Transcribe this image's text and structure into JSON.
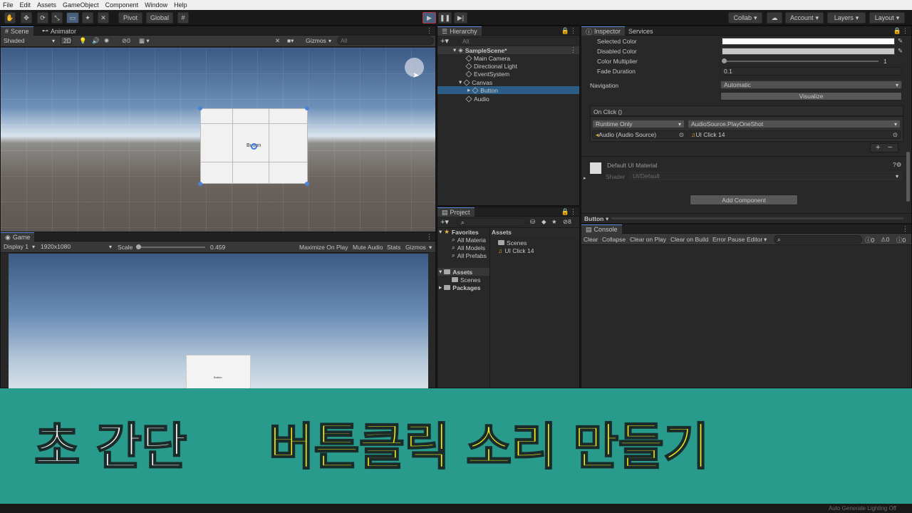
{
  "menu": [
    "File",
    "Edit",
    "Assets",
    "GameObject",
    "Component",
    "Window",
    "Help"
  ],
  "toolbar": {
    "pivot": "Pivot",
    "global": "Global",
    "collab": "Collab",
    "account": "Account",
    "layers": "Layers",
    "layout": "Layout"
  },
  "scene": {
    "tab_scene": "Scene",
    "tab_animator": "Animator",
    "shading": "Shaded",
    "mode_2d": "2D",
    "hidden_count": "0",
    "gizmos": "Gizmos",
    "search_placeholder": "All",
    "button_text": "Button"
  },
  "game": {
    "tab": "Game",
    "display": "Display 1",
    "resolution": "1920x1080",
    "scale_label": "Scale",
    "scale_value": "0.459",
    "maximize": "Maximize On Play",
    "mute": "Mute Audio",
    "stats": "Stats",
    "gizmos": "Gizmos",
    "button_text": "Button"
  },
  "hierarchy": {
    "tab": "Hierarchy",
    "search": "All",
    "scene": "SampleScene*",
    "items": [
      "Main Camera",
      "Directional Light",
      "EventSystem",
      "Canvas",
      "Button",
      "Audio"
    ]
  },
  "project": {
    "tab": "Project",
    "hidden_count": "8",
    "favorites": "Favorites",
    "fav_items": [
      "All Materia",
      "All Models",
      "All Prefabs"
    ],
    "assets_header": "Assets",
    "tree": [
      "Assets",
      "Scenes",
      "Packages"
    ],
    "asset_items": [
      "Scenes",
      "UI Click 14"
    ]
  },
  "inspector": {
    "tab": "Inspector",
    "tab_services": "Services",
    "selected_color": "Selected Color",
    "disabled_color": "Disabled Color",
    "color_multiplier": "Color Multiplier",
    "color_multiplier_value": "1",
    "fade_duration": "Fade Duration",
    "fade_duration_value": "0.1",
    "navigation": "Navigation",
    "navigation_value": "Automatic",
    "visualize": "Visualize",
    "onclick": "On Click ()",
    "runtime": "Runtime Only",
    "function": "AudioSource.PlayOneShot",
    "object": "Audio (Audio Source)",
    "clip": "UI Click 14",
    "plus": "+",
    "minus": "−",
    "material": "Default UI Material",
    "shader_label": "Shader",
    "shader_value": "UI/Default",
    "add_component": "Add Component",
    "footer": "Button"
  },
  "console": {
    "tab": "Console",
    "clear": "Clear",
    "collapse": "Collapse",
    "clear_on_play": "Clear on Play",
    "clear_on_build": "Clear on Build",
    "error_pause": "Error Pause",
    "editor": "Editor",
    "count_log": "0",
    "count_warn": "0",
    "count_err": "0"
  },
  "banner": {
    "part1": "초 간단",
    "part2": "버튼클릭 소리 만들기",
    "colors": {
      "bg": "#289b8c",
      "white": "#ffffff",
      "yellow": "#f4f218"
    }
  },
  "status": "Auto Generate Lighting Off"
}
